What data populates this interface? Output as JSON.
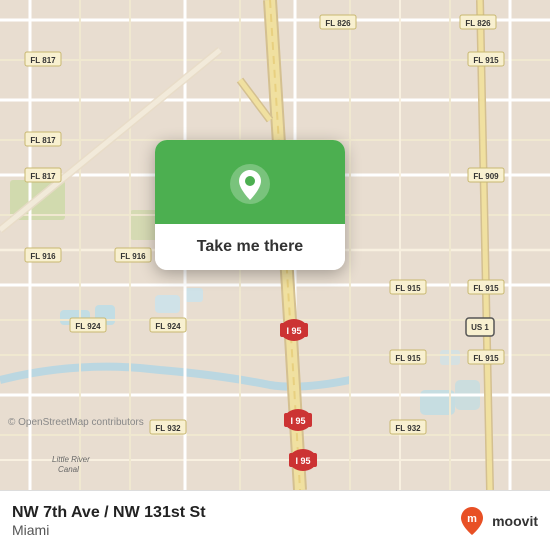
{
  "map": {
    "attribution": "© OpenStreetMap contributors",
    "background_color": "#e8e0d8"
  },
  "popup": {
    "button_label": "Take me there",
    "pin_icon": "location-pin-icon"
  },
  "bottom_bar": {
    "location_name": "NW 7th Ave / NW 131st St",
    "city": "Miami",
    "brand": "moovit"
  }
}
